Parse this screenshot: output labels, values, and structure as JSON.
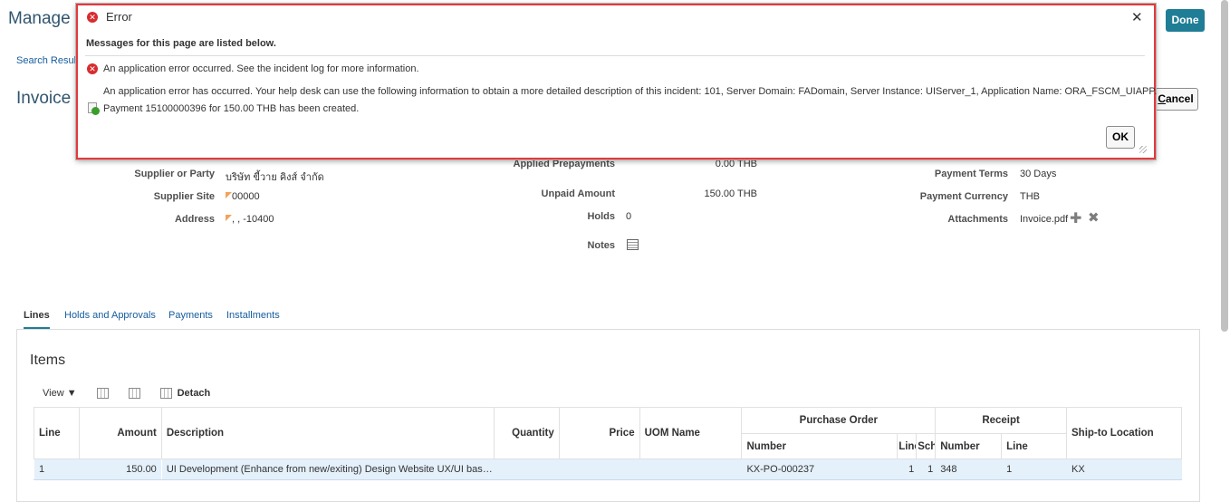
{
  "header": {
    "title": "Manage I",
    "breadcrumb": "Search Results",
    "subtitle": "Invoice D",
    "done_label": "Done",
    "cancel_prefix": "C",
    "cancel_rest": "ancel"
  },
  "details": {
    "supplier_label": "Supplier or Party",
    "supplier_value": "บริษัท ขี้วาย คิงส์ จำกัด",
    "site_label": "Supplier Site",
    "site_value": "00000",
    "address_label": "Address",
    "address_value": ", , -10400",
    "applied_prepay_label": "Applied Prepayments",
    "applied_prepay_value": "0.00 THB",
    "unpaid_label": "Unpaid Amount",
    "unpaid_value": "150.00 THB",
    "holds_label": "Holds",
    "holds_value": "0",
    "notes_label": "Notes",
    "terms_label": "Payment Terms",
    "terms_value": "30 Days",
    "currency_label": "Payment Currency",
    "currency_value": "THB",
    "attachments_label": "Attachments",
    "attachments_value": "Invoice.pdf"
  },
  "tabs": [
    {
      "label": "Lines",
      "active": true
    },
    {
      "label": "Holds and Approvals",
      "active": false
    },
    {
      "label": "Payments",
      "active": false
    },
    {
      "label": "Installments",
      "active": false
    }
  ],
  "items": {
    "title": "Items",
    "view_label": "View ▼",
    "detach_label": "Detach",
    "headers": {
      "line": "Line",
      "amount": "Amount",
      "description": "Description",
      "quantity": "Quantity",
      "price": "Price",
      "uom": "UOM Name",
      "po_group": "Purchase Order",
      "po_number": "Number",
      "po_line": "Line",
      "po_schedule": "Schedule",
      "receipt_group": "Receipt",
      "receipt_number": "Number",
      "receipt_line": "Line",
      "ship_to": "Ship-to Location"
    },
    "rows": [
      {
        "line": "1",
        "amount": "150.00",
        "description": "UI Development (Enhance from new/exiting) Design Website UX/UI bas…",
        "quantity": "",
        "price": "",
        "uom": "",
        "po_number": "KX-PO-000237",
        "po_line": "1",
        "po_schedule": "1",
        "receipt_number": "348",
        "receipt_line": "1",
        "ship_to": "KX"
      }
    ]
  },
  "dialog": {
    "title": "Error",
    "close": "✕",
    "subtitle": "Messages for this page are listed below.",
    "message1": "An application error occurred. See the incident log for more information.",
    "message2": "An application error has occurred. Your help desk can use the following information to obtain a more detailed description of this incident: 101, Server Domain: FADomain, Server Instance: UIServer_1, Application Name: ORA_FSCM_UIAPP.",
    "message3": "Payment 15100000396 for 150.00 THB has been created.",
    "ok_label": "OK"
  },
  "colors": {
    "accent": "#1f7d95",
    "error_border": "#e5383b",
    "error_icon": "#d82b2e",
    "link": "#145c9e",
    "selected_row": "#e4f0fa"
  }
}
